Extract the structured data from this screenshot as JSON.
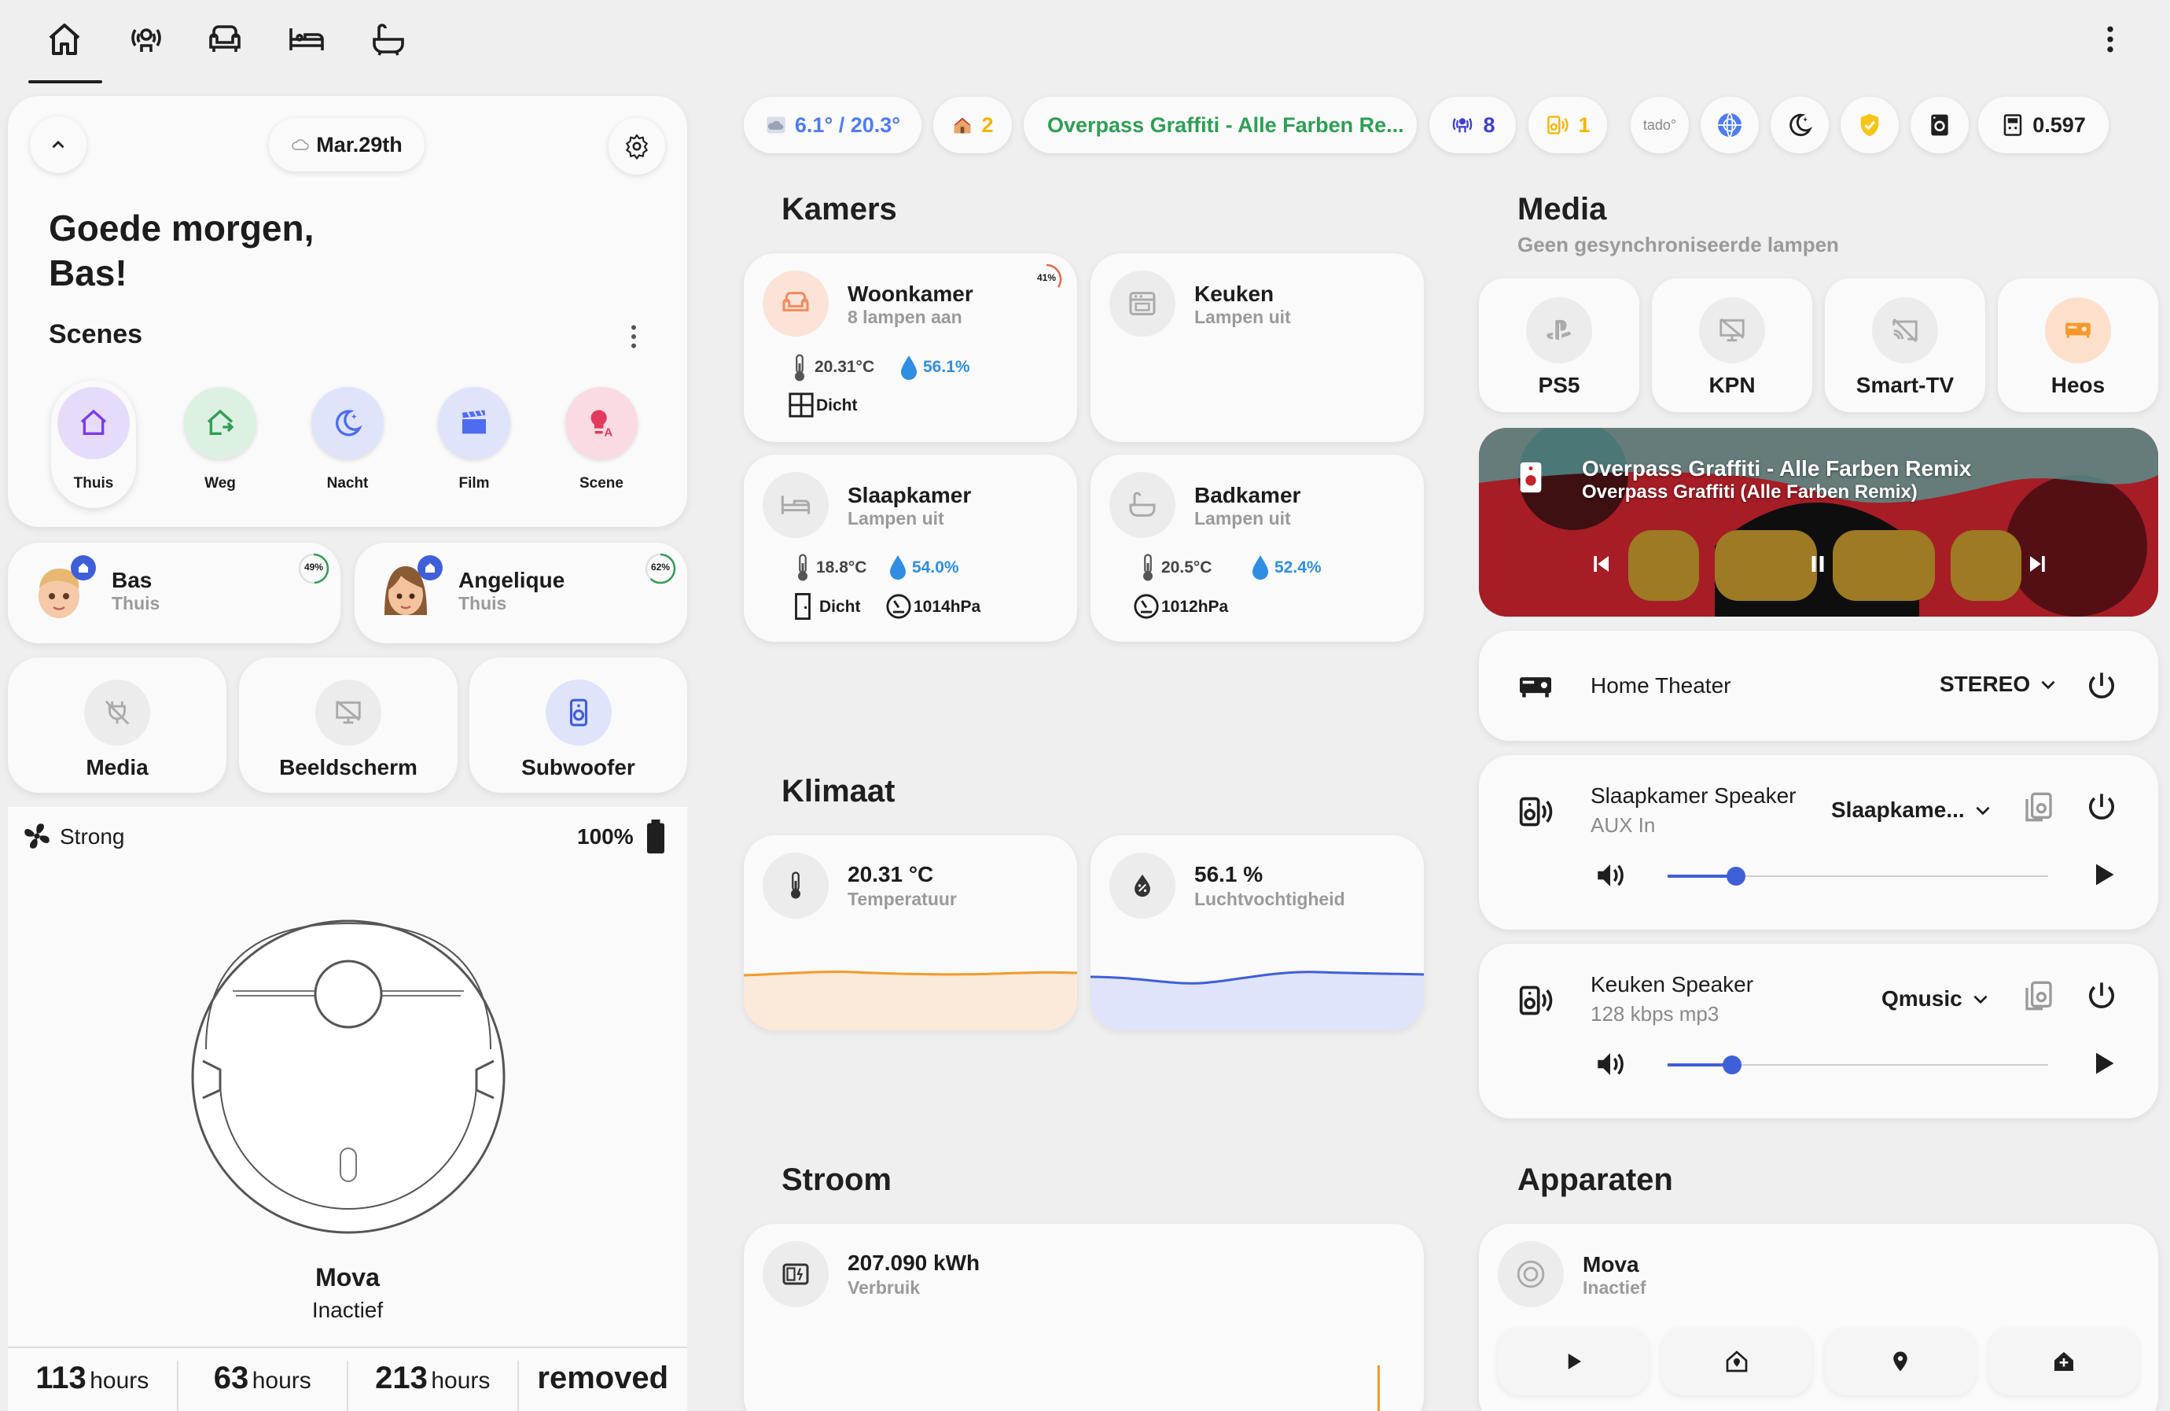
{
  "nav": {
    "tabs": [
      "home-icon",
      "occupancy-icon",
      "sofa-icon",
      "bed-icon",
      "bathtub-icon"
    ],
    "menu_icon": "dots-vertical-icon"
  },
  "header_card": {
    "date": "Mar.29th",
    "greeting": "Goede morgen,\nBas!",
    "scenes_title": "Scenes"
  },
  "scenes": [
    {
      "label": "Thuis",
      "icon": "home-icon",
      "color": "#7c3aed",
      "bg": "#e6dcfa"
    },
    {
      "label": "Weg",
      "icon": "home-export-icon",
      "color": "#2e9e54",
      "bg": "#dcf1e2"
    },
    {
      "label": "Nacht",
      "icon": "moon-icon",
      "color": "#4d6cf0",
      "bg": "#dfe4fb"
    },
    {
      "label": "Film",
      "icon": "clapperboard-icon",
      "color": "#4d6cf0",
      "bg": "#dfe4fb"
    },
    {
      "label": "Scene",
      "icon": "bulb-alert-icon",
      "color": "#e23a5c",
      "bg": "#fbdbe2"
    }
  ],
  "persons": [
    {
      "name": "Bas",
      "status": "Thuis",
      "battery": "49%",
      "battery_fraction": 0.49
    },
    {
      "name": "Angelique",
      "status": "Thuis",
      "battery": "62%",
      "battery_fraction": 0.62
    }
  ],
  "quick": [
    {
      "label": "Media",
      "icon": "plug-off-icon"
    },
    {
      "label": "Beeldscherm",
      "icon": "monitor-off-icon"
    },
    {
      "label": "Subwoofer",
      "icon": "speaker-icon"
    }
  ],
  "vacuum": {
    "fan": "Strong",
    "battery": "100%",
    "name": "Mova",
    "state": "Inactief",
    "stats": [
      {
        "n": "113",
        "u": "hours"
      },
      {
        "n": "63",
        "u": "hours"
      },
      {
        "n": "213",
        "u": "hours"
      },
      {
        "n": "removed",
        "u": ""
      }
    ]
  },
  "status_bar": {
    "weather": "6.1° / 20.3°",
    "home_count": "2",
    "now_playing": "Overpass Graffiti - Alle Farben Re...",
    "lights": "8",
    "speakers": "1",
    "tado": "tado°",
    "energy": "0.597"
  },
  "sections": {
    "rooms": "Kamers",
    "climate": "Klimaat",
    "power": "Stroom",
    "media": "Media",
    "media_sub": "Geen gesynchroniseerde lampen",
    "devices": "Apparaten"
  },
  "rooms": [
    {
      "name": "Woonkamer",
      "sub": "8 lampen aan",
      "badge": "41%",
      "temp": "20.31°C",
      "hum": "56.1%",
      "extra1": "Dicht",
      "extra2": ""
    },
    {
      "name": "Keuken",
      "sub": "Lampen uit"
    },
    {
      "name": "Slaapkamer",
      "sub": "Lampen uit",
      "temp": "18.8°C",
      "hum": "54.0%",
      "extra1": "Dicht",
      "extra2": "1014hPa"
    },
    {
      "name": "Badkamer",
      "sub": "Lampen uit",
      "temp": "20.5°C",
      "hum": "52.4%",
      "extra2": "1012hPa"
    }
  ],
  "climate": [
    {
      "value": "20.31 °C",
      "label": "Temperatuur",
      "line_color": "#f39a2b",
      "fill": "#fbe9da"
    },
    {
      "value": "56.1 %",
      "label": "Luchtvochtigheid",
      "line_color": "#3f5fd9",
      "fill": "#dfe4fb"
    }
  ],
  "power": {
    "value": "207.090 kWh",
    "label": "Verbruik"
  },
  "media_sources": [
    {
      "label": "PS5",
      "active": false
    },
    {
      "label": "KPN",
      "active": false
    },
    {
      "label": "Smart-TV",
      "active": false
    },
    {
      "label": "Heos",
      "active": true
    }
  ],
  "player": {
    "title": "Overpass Graffiti - Alle Farben Remix",
    "artist": "Overpass Graffiti (Alle Farben Remix)"
  },
  "home_theater": {
    "name": "Home Theater",
    "mode": "STEREO"
  },
  "speakers": [
    {
      "name": "Slaapkamer Speaker",
      "sub": "AUX In",
      "source": "Slaapkame...",
      "volume": 0.18
    },
    {
      "name": "Keuken Speaker",
      "sub": "128 kbps mp3",
      "source": "Qmusic",
      "volume": 0.17
    }
  ],
  "devices": [
    {
      "name": "Mova",
      "status": "Inactief"
    }
  ],
  "colors": {
    "accent": "#3f5fd9",
    "green": "#2e9e54",
    "gold": "#f5b400"
  }
}
